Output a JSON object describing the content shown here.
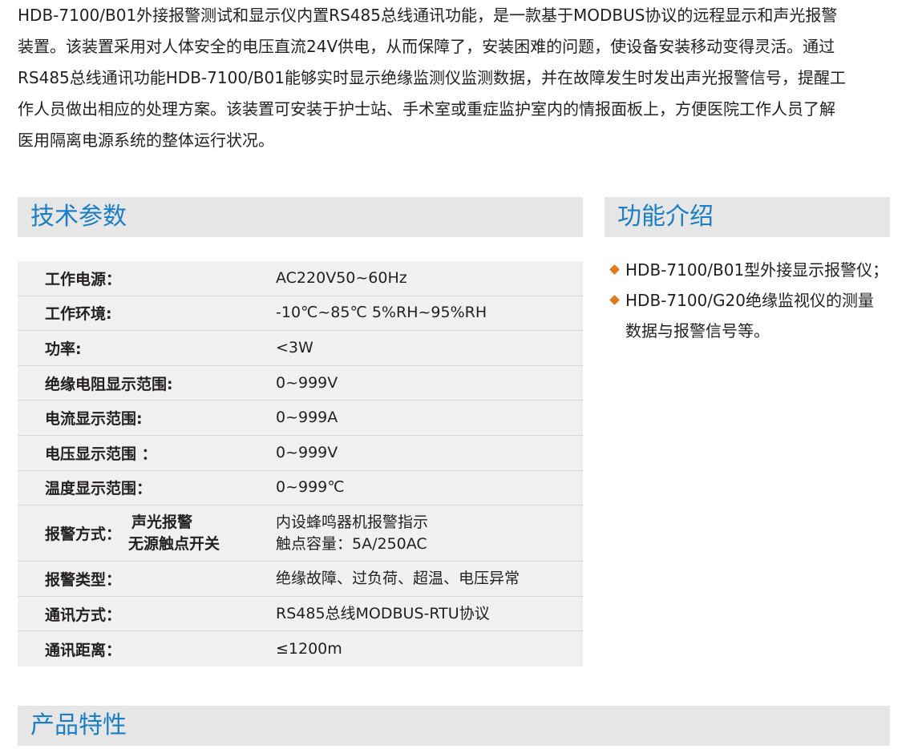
{
  "intro": {
    "lines": [
      "HDB-7100/B01外接报警测试和显示仪内置RS485总线通讯功能，是一款基于MODBUS协议的远程显示和声光报警",
      "装置。该装置采用对人体安全的电压直流24V供电，从而保障了，安装困难的问题，使设备安装移动变得灵活。通过",
      "RS485总线通讯功能HDB-7100/B01能够实时显示绝缘监测仪监测数据，并在故障发生时发出声光报警信号，提醒工",
      "作人员做出相应的处理方案。该装置可安装于护士站、手术室或重症监护室内的情报面板上，方便医院工作人员了解",
      "医用隔离电源系统的整体运行状况。"
    ]
  },
  "sections": {
    "tech": "技术参数",
    "func": "功能介绍",
    "feat": "产品特性"
  },
  "specs": [
    {
      "label": "工作电源：",
      "value": "AC220V50~60Hz"
    },
    {
      "label": "工作环境:",
      "value": "-10℃~85℃ 5%RH~95%RH"
    },
    {
      "label": "功率:",
      "value": "<3W"
    },
    {
      "label": "绝缘电阻显示范围:",
      "value": "0~999V"
    },
    {
      "label": "电流显示范围:",
      "value": "0~999A"
    },
    {
      "label": "电压显示范围 ：",
      "value": "0~999V"
    },
    {
      "label": "温度显示范围：",
      "value": "0~999℃"
    }
  ],
  "alarm": {
    "label": "报警方式：",
    "sub1": "声光报警",
    "sub2": "无源触点开关",
    "value1": "内设蜂鸣器机报警指示",
    "value2": "触点容量：5A/250AC"
  },
  "specs2": [
    {
      "label": "报警类型：",
      "value": "绝缘故障、过负荷、超温、电压异常"
    },
    {
      "label": "通讯方式：",
      "value": "RS485总线MODBUS-RTU协议"
    },
    {
      "label": "通讯距离：",
      "value": "≤1200m"
    }
  ],
  "functions": [
    {
      "line1": "HDB-7100/B01型外接显示报警仪；",
      "line2": ""
    },
    {
      "line1": "HDB-7100/G20绝缘监视仪的测量",
      "line2": "数据与报警信号等。"
    }
  ],
  "colors": {
    "accent": "#1a7fc4",
    "bullet": "#e07a1a",
    "bar": "#e6e6e6",
    "table": "#f0f0f0"
  }
}
